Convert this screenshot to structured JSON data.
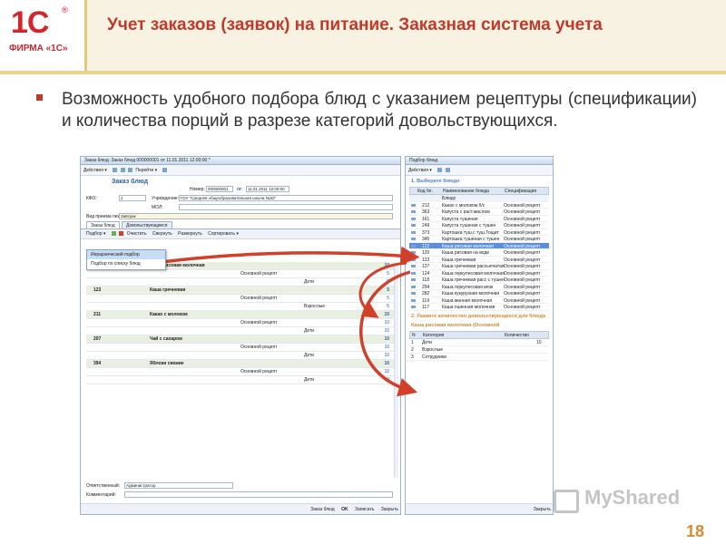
{
  "header": {
    "logo_mark": "1С",
    "logo_reg": "®",
    "logo_company": "ФИРМА «1С»",
    "title": "Учет заказов (заявок) на питание. Заказная система учета"
  },
  "bullet": {
    "text": "Возможность удобного подбора блюд с указанием рецептуры (спецификации) и количества порций в разрезе категорий довольствующихся."
  },
  "order_window": {
    "title": "Заказ блюд: Заказ блюд 000000001 от 11.01.2011 12:00:00 *",
    "toolbar": [
      "Действия ▾",
      "Перейти ▾"
    ],
    "form_title": "Заказ блюд",
    "number_label": "Номер:",
    "number_value": "000000001",
    "date_label": "от:",
    "date_value": "11.01.2011 12:00:00",
    "kfo_label": "КФО:",
    "kfo_value": "2",
    "institution_label": "Учреждение:",
    "institution_value": "ГОУ \"Средняя общеобразовательная школа №32\"",
    "mol_label": "МОЛ:",
    "meal_label": "Вид приема пищи:",
    "meal_value": "Завтрак",
    "tabs": [
      "Заказ блюд",
      "Довольствующиеся"
    ],
    "inner_toolbar": [
      "Подбор ▾",
      "Очистить",
      "Свернуть",
      "Развернуть",
      "Сортировать ▾"
    ],
    "menu_items": [
      "Иерархический подбор",
      "Подбор по списку блюд"
    ],
    "rows": [
      {
        "kind": "cat",
        "code": "",
        "name": "Каша рисовая молочная",
        "qty": "10"
      },
      {
        "kind": "sub",
        "code": "",
        "name": "Основной рецепт",
        "qty": "5"
      },
      {
        "kind": "sub2",
        "code": "",
        "name": "Дети",
        "qty": "5"
      },
      {
        "kind": "cat",
        "code": "123",
        "name": "Каша гречневая",
        "qty": "5"
      },
      {
        "kind": "sub",
        "code": "",
        "name": "Основной рецепт",
        "qty": "5"
      },
      {
        "kind": "sub2",
        "code": "",
        "name": "Взрослые",
        "qty": "5"
      },
      {
        "kind": "cat",
        "code": "211",
        "name": "Какао с молоком",
        "qty": "10"
      },
      {
        "kind": "sub",
        "code": "",
        "name": "Основной рецепт",
        "qty": "10"
      },
      {
        "kind": "sub2",
        "code": "",
        "name": "Дети",
        "qty": "10"
      },
      {
        "kind": "cat",
        "code": "207",
        "name": "Чай с сахаром",
        "qty": "10"
      },
      {
        "kind": "sub",
        "code": "",
        "name": "Основной рецепт",
        "qty": "10"
      },
      {
        "kind": "sub2",
        "code": "",
        "name": "Дети",
        "qty": "10"
      },
      {
        "kind": "cat",
        "code": "394",
        "name": "Яблоки свежие",
        "qty": "10"
      },
      {
        "kind": "sub",
        "code": "",
        "name": "Основной рецепт",
        "qty": "10"
      },
      {
        "kind": "sub2",
        "code": "",
        "name": "Дети",
        "qty": "10"
      }
    ],
    "responsible_label": "Ответственный:",
    "responsible_value": "Администратор",
    "comment_label": "Комментарий:",
    "footer_buttons": [
      "Заказ блюд",
      "OK",
      "Записать",
      "Закрыть"
    ]
  },
  "picker_window": {
    "title": "Подбор блюд",
    "toolbar": "Действия ▾",
    "step1": "1. Выберите блюдо",
    "columns": [
      "Код бл.",
      "Наименование блюда",
      "Спецификация"
    ],
    "subheader": "Блюдо",
    "rows": [
      {
        "code": "212",
        "name": "Какао с молоком б/с",
        "spec": "Основной рецепт"
      },
      {
        "code": "363",
        "name": "Капуста с раст.маслом",
        "spec": "Основной рецепт"
      },
      {
        "code": "161",
        "name": "Капуста тушеная",
        "spec": "Основной рецепт"
      },
      {
        "code": "249",
        "name": "Капуста тушеная с тушен",
        "spec": "Основной рецепт"
      },
      {
        "code": "373",
        "name": "Картошка туш.с туш.Тощит",
        "spec": "Основной рецепт"
      },
      {
        "code": "345",
        "name": "Картошка тушеная с тушен",
        "spec": "Основной рецепт"
      },
      {
        "code": "122",
        "name": "Каша рисовая молочная",
        "spec": "Основной рецепт"
      },
      {
        "code": "120",
        "name": "Каша рисовая на воде",
        "spec": "Основной рецепт"
      },
      {
        "code": "123",
        "name": "Каша гречневая",
        "spec": "Основной рецепт"
      },
      {
        "code": "127",
        "name": "Каша гречневая рассыпчатая",
        "spec": "Основной рецепт"
      },
      {
        "code": "124",
        "name": "Каша геркулесовая молочная",
        "spec": "Основной рецепт"
      },
      {
        "code": "118",
        "name": "Каша гречневая расс с тушен",
        "spec": "Основной рецепт"
      },
      {
        "code": "294",
        "name": "Каша геркулесовая вязк",
        "spec": "Основной рецепт"
      },
      {
        "code": "282",
        "name": "Каша кукурузная молочная",
        "spec": "Основной рецепт"
      },
      {
        "code": "119",
        "name": "Каша манная молочная",
        "spec": "Основной рецепт"
      },
      {
        "code": "117",
        "name": "Каша пшенная молочная",
        "spec": "Основной рецепт"
      }
    ],
    "highlight_index": 6,
    "step2": "2. Укажите количество довольствующихся для блюда",
    "step2_dish": "Каша рисовая молочная (Основной",
    "columns2": [
      "N",
      "Категория",
      "Количество"
    ],
    "rows2": [
      {
        "n": "1",
        "cat": "Дети",
        "qty": "10"
      },
      {
        "n": "2",
        "cat": "Взрослые",
        "qty": ""
      },
      {
        "n": "3",
        "cat": "Сотрудники",
        "qty": ""
      }
    ],
    "footer": "Закрыть"
  },
  "watermark": "MyShared",
  "page_number": "18",
  "colors": {
    "accent": "#c0392b",
    "arrow": "#d0402a",
    "header_bg": "#f7f2e1",
    "page_number": "#d58b2f"
  }
}
